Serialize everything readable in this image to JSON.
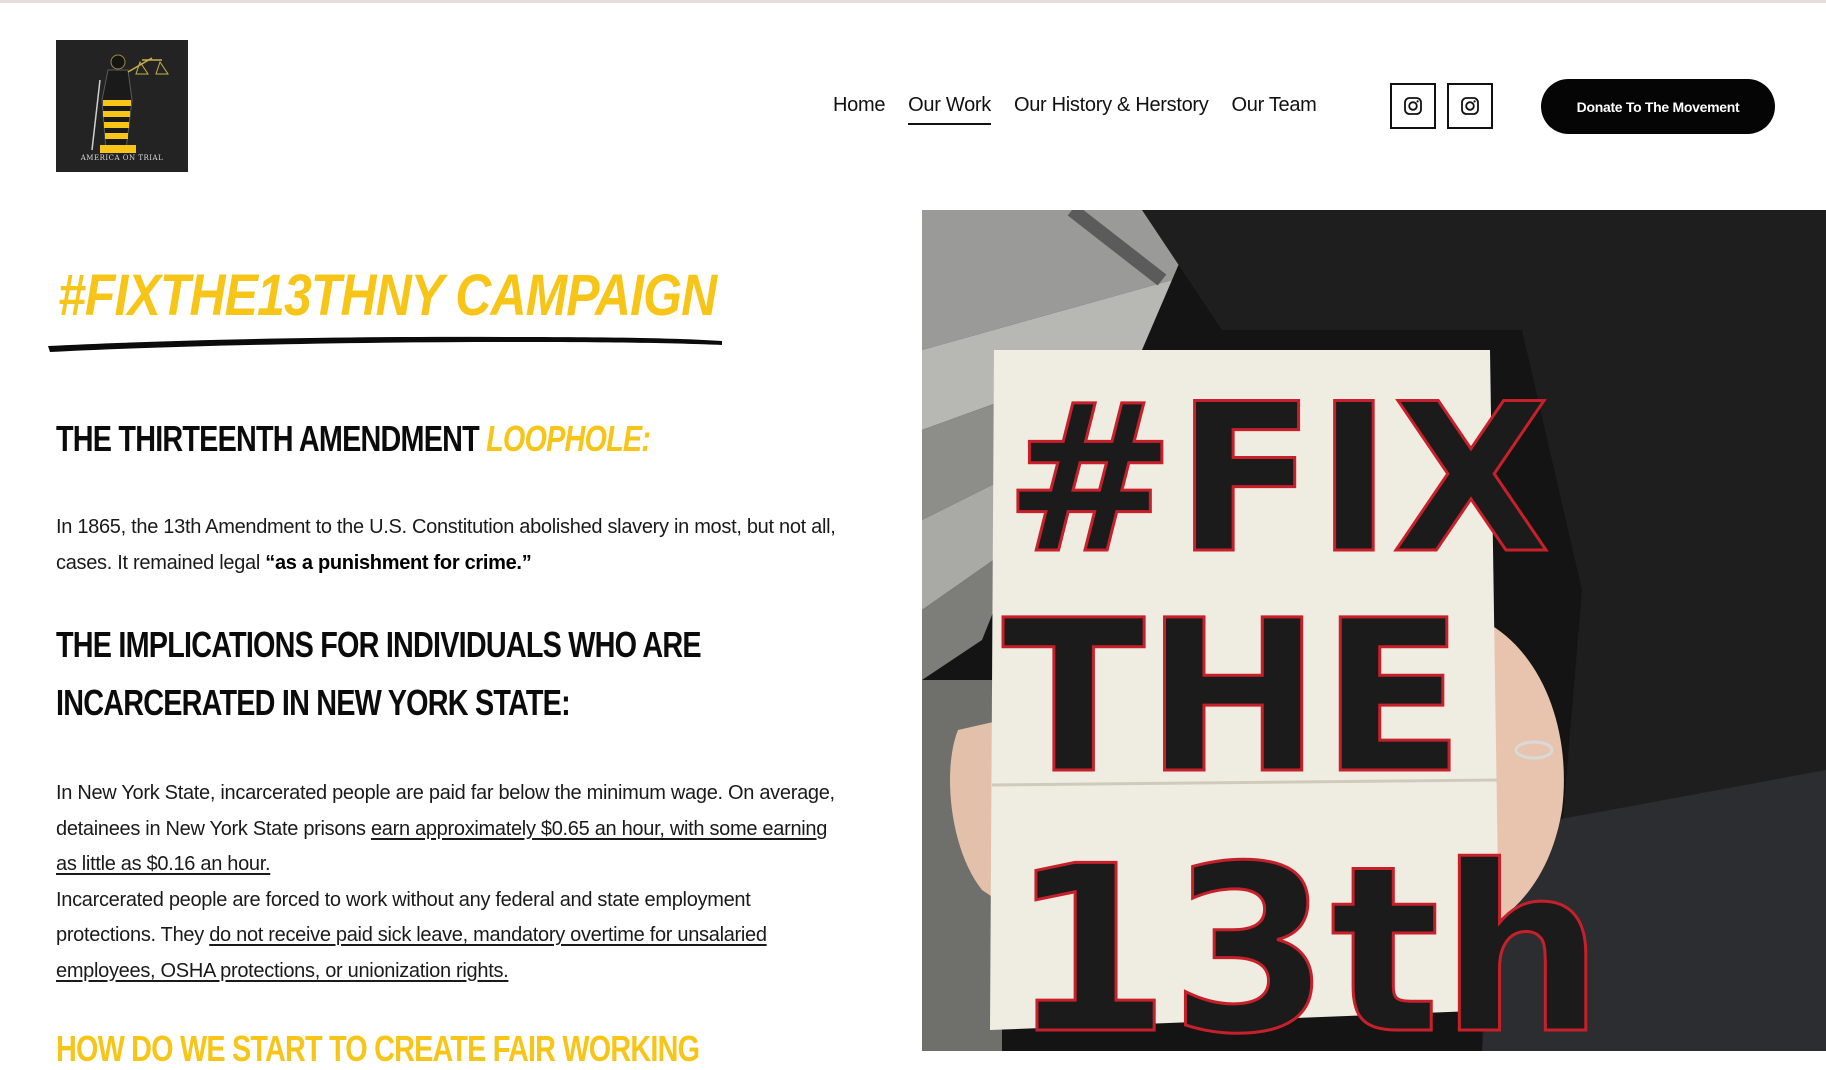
{
  "header": {
    "logo_caption": "AMERICA ON TRIAL",
    "nav": [
      {
        "label": "Home",
        "active": false
      },
      {
        "label": "Our Work",
        "active": true
      },
      {
        "label": "Our History & Herstory",
        "active": false
      },
      {
        "label": "Our Team",
        "active": false
      }
    ],
    "social": [
      {
        "icon": "instagram-icon"
      },
      {
        "icon": "instagram-icon"
      }
    ],
    "donate_label": "Donate To The Movement"
  },
  "main": {
    "campaign_title": "#FIXTHE13THNY CAMPAIGN",
    "section1": {
      "heading": "THE THIRTEENTH AMENDMENT",
      "heading_accent": "LOOPHOLE:",
      "text_1": "In 1865, the 13th Amendment to the U.S. Constitution abolished slavery in most, but not all, cases. It remained legal ",
      "text_bold": "“as a punishment for crime.”"
    },
    "section2": {
      "heading_line1": "THE IMPLICATIONS FOR INDIVIDUALS WHO ARE",
      "heading_line2": "INCARCERATED IN NEW YORK STATE:",
      "p1_text": "In New York State, incarcerated people are paid far below the minimum wage. On average, detainees in New York State prisons ",
      "p1_link": "earn approximately $0.65 an hour, with some earning as little as $0.16 an hour.",
      "p2_text": "Incarcerated people are forced to work without any federal and state employment protections. They ",
      "p2_link": "do not receive paid sick leave, mandatory overtime for unsalaried employees, OSHA protections, or unionization rights."
    },
    "next_heading_partial": "HOW DO WE START TO CREATE FAIR WORKING"
  },
  "photo": {
    "sign_line1": "#FIX",
    "sign_line2": "THE",
    "sign_line3": "13th"
  },
  "colors": {
    "accent": "#f7c518",
    "donate_bg": "#050505",
    "sign_red": "#c8202a"
  }
}
